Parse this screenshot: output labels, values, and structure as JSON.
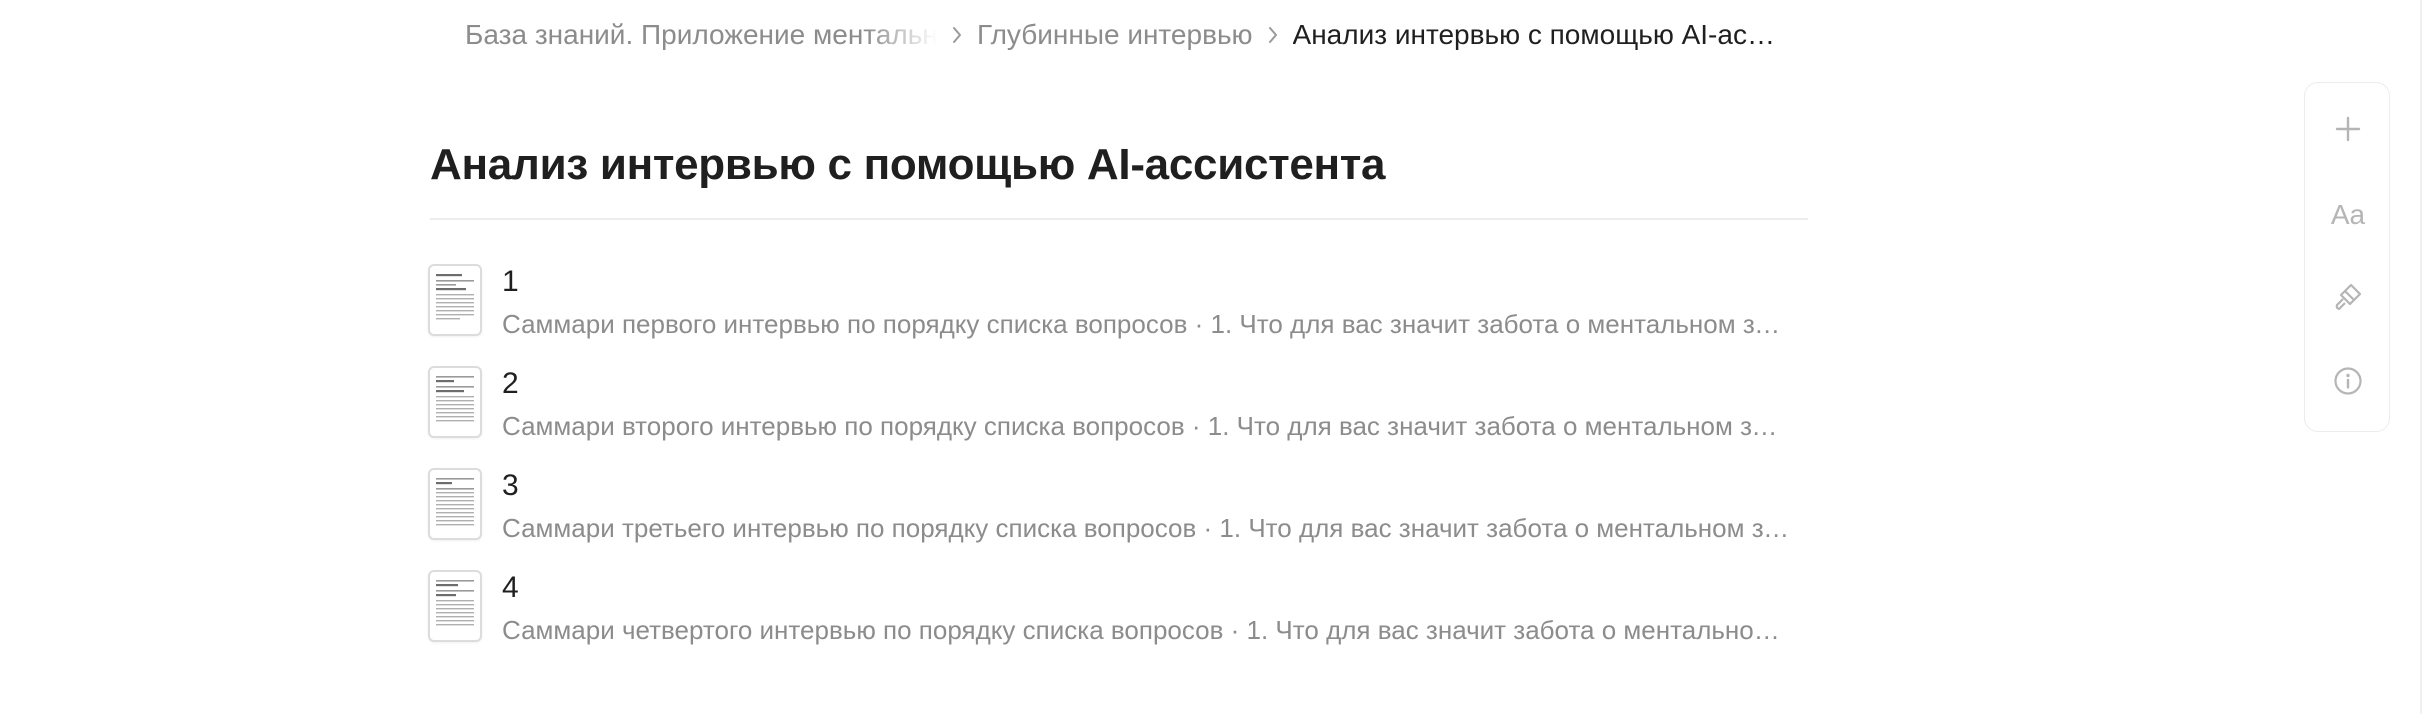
{
  "breadcrumb": {
    "items": [
      {
        "label": "База знаний. Приложение ментального здоровья"
      },
      {
        "label": "Глубинные интервью"
      },
      {
        "label": "Анализ интервью с помощью AI-ассистента"
      }
    ]
  },
  "page": {
    "title": "Анализ интервью с помощью AI-ассистента"
  },
  "documents": [
    {
      "number": "1",
      "summary": "Саммари первого интервью по порядку списка вопросов · 1. Что для вас значит забота о ментальном здоровье?"
    },
    {
      "number": "2",
      "summary": "Саммари второго интервью по порядку списка вопросов · 1. Что для вас значит забота о ментальном здоровье?"
    },
    {
      "number": "3",
      "summary": "Саммари третьего интервью по порядку списка вопросов · 1. Что для вас значит забота о ментальном здоровье?"
    },
    {
      "number": "4",
      "summary": "Саммари четвертого интервью по порядку списка вопросов · 1. Что для вас значит забота о ментальном здоровье?"
    }
  ],
  "toolbar": {
    "add_icon": "plus-icon",
    "text_style_label": "Aa",
    "style_icon": "paintbrush-icon",
    "info_icon": "info-icon"
  },
  "colors": {
    "text_primary": "#1f1f1f",
    "text_secondary": "#8c8c8c",
    "icon_muted": "#b5b5b5",
    "divider": "#ececec"
  }
}
